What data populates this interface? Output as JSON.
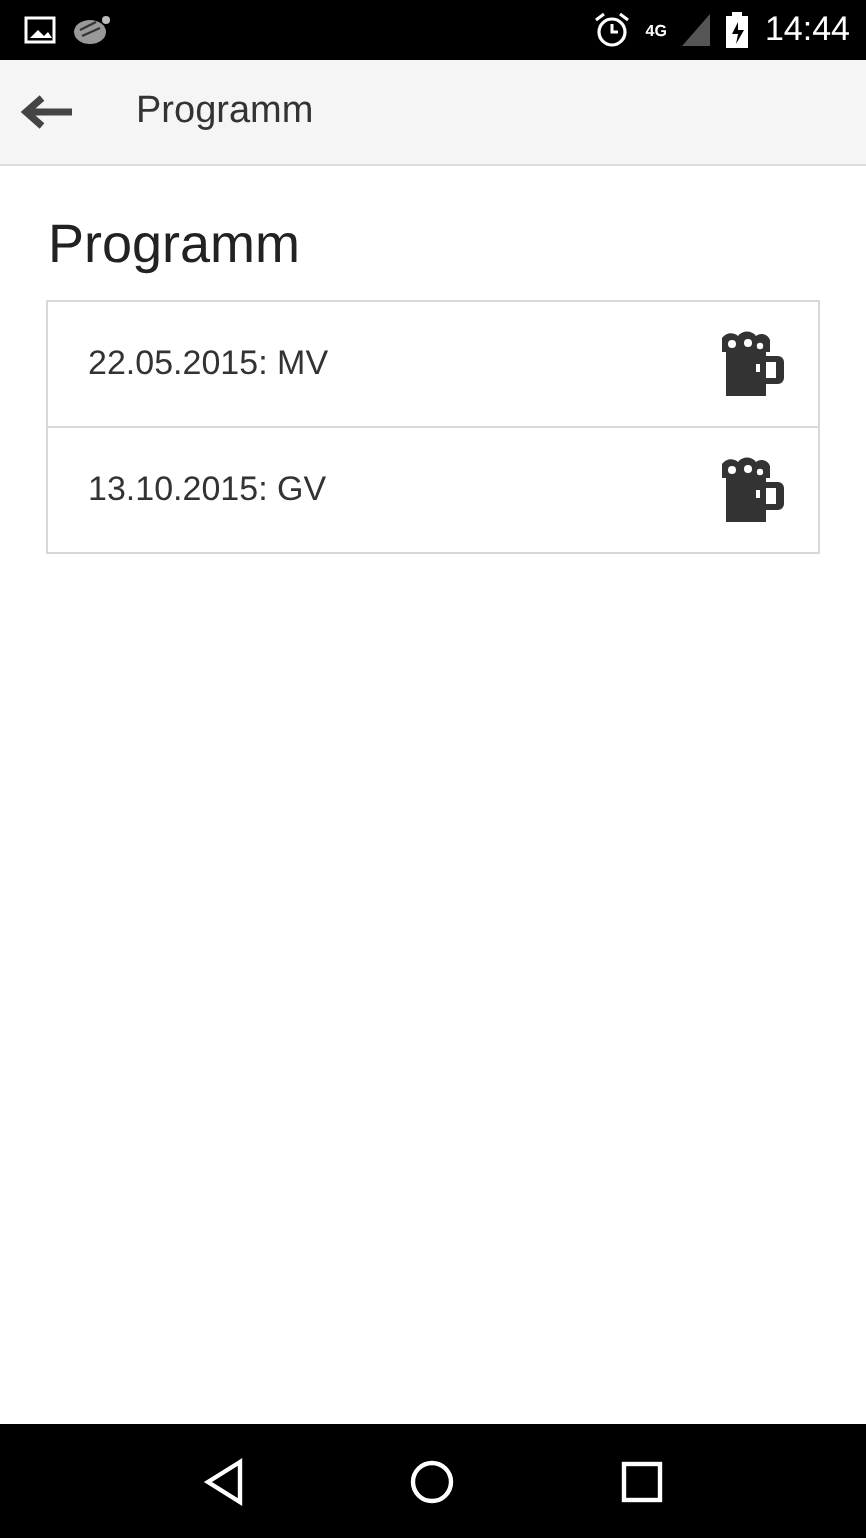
{
  "status_bar": {
    "network": "4G",
    "time": "14:44"
  },
  "toolbar": {
    "title": "Programm"
  },
  "heading": "Programm",
  "events": [
    {
      "label": "22.05.2015: MV"
    },
    {
      "label": "13.10.2015: GV"
    }
  ]
}
